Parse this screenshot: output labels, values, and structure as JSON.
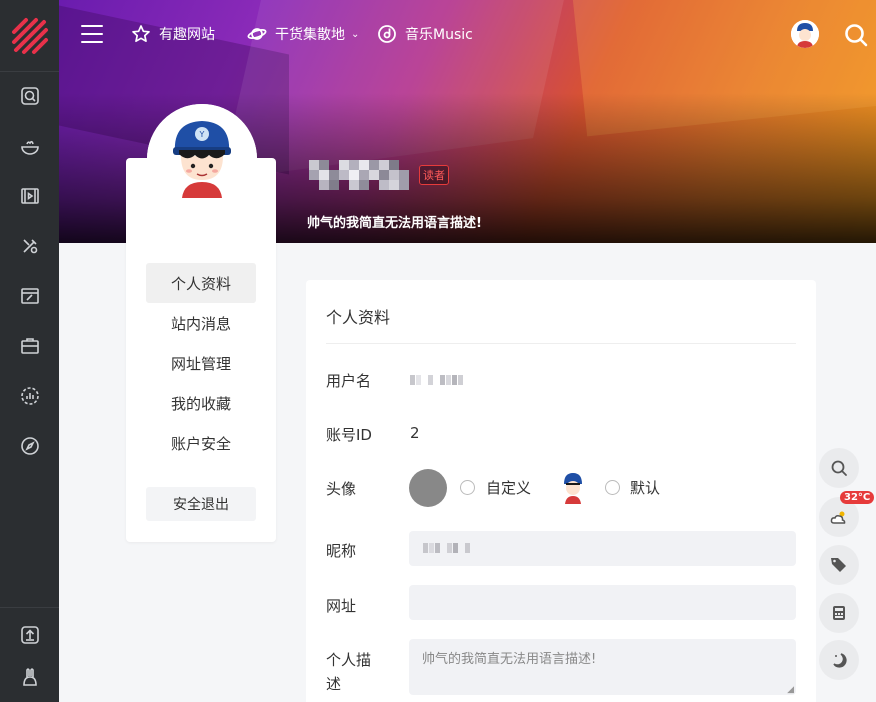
{
  "nav": {
    "items": [
      {
        "label": "有趣网站",
        "icon": "star-icon"
      },
      {
        "label": "干货集散地",
        "icon": "planet-icon"
      },
      {
        "label": "音乐Music",
        "icon": "music-disc-icon"
      }
    ]
  },
  "profile": {
    "badge": "读者",
    "description": "帅气的我简直无法用语言描述!"
  },
  "sidebar": {
    "items": [
      {
        "label": "个人资料"
      },
      {
        "label": "站内消息"
      },
      {
        "label": "网址管理"
      },
      {
        "label": "我的收藏"
      },
      {
        "label": "账户安全"
      }
    ],
    "logout": "安全退出"
  },
  "main": {
    "title": "个人资料",
    "username_label": "用户名",
    "account_id_label": "账号ID",
    "account_id": "2",
    "avatar_label": "头像",
    "avatar_custom": "自定义",
    "avatar_default": "默认",
    "nickname_label": "昵称",
    "website_label": "网址",
    "bio_label": "个人描\n述",
    "bio_placeholder": "帅气的我简直无法用语言描述!"
  },
  "tools": {
    "temperature": "32°C"
  },
  "colors": {
    "rail": "#2b2e31",
    "badge": "#e63b3b",
    "logo": "#e8314a"
  }
}
